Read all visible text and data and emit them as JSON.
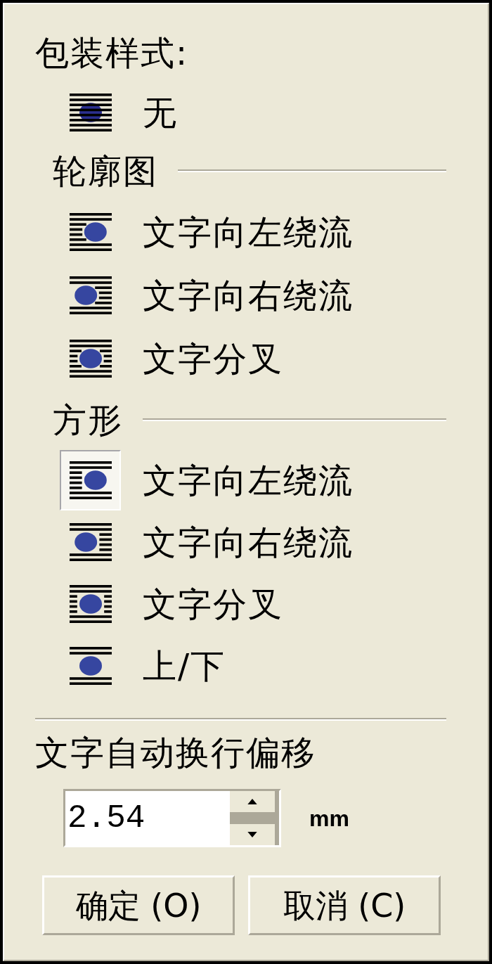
{
  "title": "包装样式:",
  "none_option": {
    "kind": "none",
    "label": "无",
    "selected": false
  },
  "groups": [
    {
      "heading": "轮廓图",
      "options": [
        {
          "kind": "contour-left",
          "label": "文字向左绕流",
          "selected": false
        },
        {
          "kind": "contour-right",
          "label": "文字向右绕流",
          "selected": false
        },
        {
          "kind": "contour-split",
          "label": "文字分叉",
          "selected": false
        }
      ]
    },
    {
      "heading": "方形",
      "options": [
        {
          "kind": "square-left",
          "label": "文字向左绕流",
          "selected": true
        },
        {
          "kind": "square-right",
          "label": "文字向右绕流",
          "selected": false
        },
        {
          "kind": "square-split",
          "label": "文字分叉",
          "selected": false
        },
        {
          "kind": "square-top-bottom",
          "label": "上/下",
          "selected": false
        }
      ]
    }
  ],
  "offset": {
    "label": "文字自动换行偏移",
    "value": "2.54",
    "unit": "mm"
  },
  "buttons": [
    {
      "label": "确定 (O)"
    },
    {
      "label": "取消 (C)"
    }
  ]
}
